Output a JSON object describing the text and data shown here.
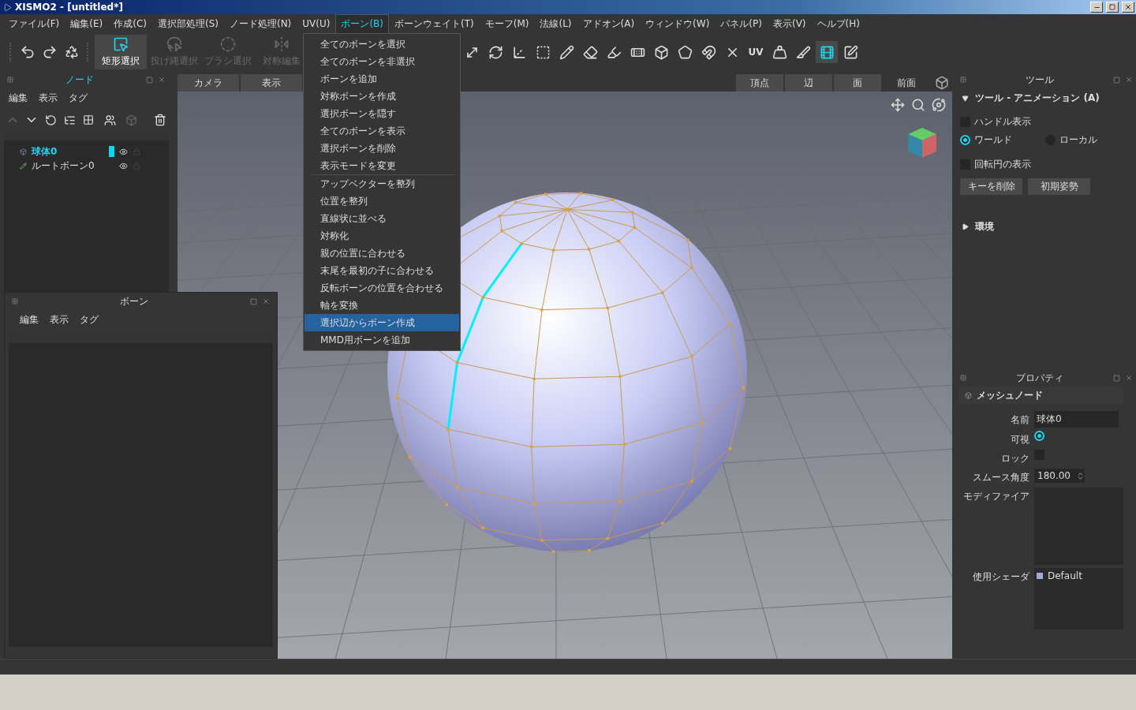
{
  "window": {
    "title": "XISMO2 - [untitled*]"
  },
  "menu_bar": [
    {
      "label": "ファイル(F)",
      "selected": false
    },
    {
      "label": "編集(E)",
      "selected": false
    },
    {
      "label": "作成(C)",
      "selected": false
    },
    {
      "label": "選択部処理(S)",
      "selected": false
    },
    {
      "label": "ノード処理(N)",
      "selected": false
    },
    {
      "label": "UV(U)",
      "selected": false
    },
    {
      "label": "ボーン(B)",
      "selected": true
    },
    {
      "label": "ボーンウェイト(T)",
      "selected": false
    },
    {
      "label": "モーフ(M)",
      "selected": false
    },
    {
      "label": "法線(L)",
      "selected": false
    },
    {
      "label": "アドオン(A)",
      "selected": false
    },
    {
      "label": "ウィンドウ(W)",
      "selected": false
    },
    {
      "label": "パネル(P)",
      "selected": false
    },
    {
      "label": "表示(V)",
      "selected": false
    },
    {
      "label": "ヘルプ(H)",
      "selected": false
    }
  ],
  "dropdown_menu": {
    "groups": [
      [
        {
          "label": "全てのボーンを選択",
          "selected": false
        },
        {
          "label": "全てのボーンを非選択",
          "selected": false
        },
        {
          "label": "ボーンを追加",
          "selected": false
        },
        {
          "label": "対称ボーンを作成",
          "selected": false
        },
        {
          "label": "選択ボーンを隠す",
          "selected": false
        },
        {
          "label": "全てのボーンを表示",
          "selected": false
        },
        {
          "label": "選択ボーンを削除",
          "selected": false
        },
        {
          "label": "表示モードを変更",
          "selected": false
        }
      ],
      [
        {
          "label": "アップベクターを整列",
          "selected": false
        },
        {
          "label": "位置を整列",
          "selected": false
        },
        {
          "label": "直線状に並べる",
          "selected": false
        },
        {
          "label": "対称化",
          "selected": false
        },
        {
          "label": "親の位置に合わせる",
          "selected": false
        },
        {
          "label": "末尾を最初の子に合わせる",
          "selected": false
        },
        {
          "label": "反転ボーンの位置を合わせる",
          "selected": false
        },
        {
          "label": "軸を変換",
          "selected": false
        },
        {
          "label": "選択辺からボーン作成",
          "selected": true
        },
        {
          "label": "MMD用ボーンを追加",
          "selected": false
        }
      ]
    ]
  },
  "toolbar": {
    "select_tools": [
      {
        "label": "矩形選択",
        "selected": true
      },
      {
        "label": "投げ縄選択",
        "selected": false
      },
      {
        "label": "ブラシ選択",
        "selected": false
      },
      {
        "label": "対称編集",
        "selected": false
      }
    ],
    "view_tools": [
      {
        "selected": false
      },
      {
        "selected": false
      },
      {
        "selected": false
      },
      {
        "selected": false
      },
      {
        "selected": false
      },
      {
        "selected": false
      },
      {
        "selected": false
      },
      {
        "selected": false
      },
      {
        "selected": false
      },
      {
        "selected": false
      },
      {
        "selected": false
      },
      {
        "selected": false
      },
      {
        "label": "UV",
        "selected": false
      },
      {
        "selected": false
      },
      {
        "selected": false
      },
      {
        "selected": true
      },
      {
        "selected": false
      }
    ]
  },
  "node_panel": {
    "title": "ノード",
    "menu": [
      "編集",
      "表示",
      "タグ"
    ],
    "nodes": [
      {
        "name": "球体0",
        "kind": "mesh",
        "selected": true,
        "visible": true
      },
      {
        "name": "ルートボーン0",
        "kind": "bone",
        "selected": false,
        "visible": true
      }
    ]
  },
  "bone_panel": {
    "title": "ボーン",
    "menu": [
      "編集",
      "表示",
      "タグ"
    ]
  },
  "viewport": {
    "left_tabs": [
      "カメラ",
      "表示"
    ],
    "mode_tabs": [
      {
        "label": "頂点",
        "selected": false
      },
      {
        "label": "辺",
        "selected": false
      },
      {
        "label": "面",
        "selected": false
      },
      {
        "label": "前面",
        "selected": true
      }
    ]
  },
  "tool_panel": {
    "title": "ツール",
    "sections": [
      {
        "title": "ツール - アニメーション (A)",
        "expanded": true
      },
      {
        "title": "環境",
        "expanded": false
      }
    ],
    "handle_display": {
      "label": "ハンドル表示",
      "checked": false
    },
    "coordinates": [
      {
        "label": "ワールド",
        "selected": true
      },
      {
        "label": "ローカル",
        "selected": false
      }
    ],
    "rotation_circle": {
      "label": "回転円の表示",
      "checked": false
    },
    "buttons": [
      "キーを削除",
      "初期姿勢"
    ]
  },
  "property_panel": {
    "title": "プロパティ",
    "header": "メッシュノード",
    "name": {
      "label": "名前",
      "value": "球体0"
    },
    "visible": {
      "label": "可視",
      "checked": true
    },
    "lock": {
      "label": "ロック",
      "checked": false
    },
    "smooth_angle": {
      "label": "スムース角度",
      "value": "180.00"
    },
    "modifier": {
      "label": "モディファイア"
    },
    "shader": {
      "label": "使用シェーダ",
      "items": [
        {
          "name": "Default",
          "color": "#a0a6d8"
        }
      ]
    }
  }
}
